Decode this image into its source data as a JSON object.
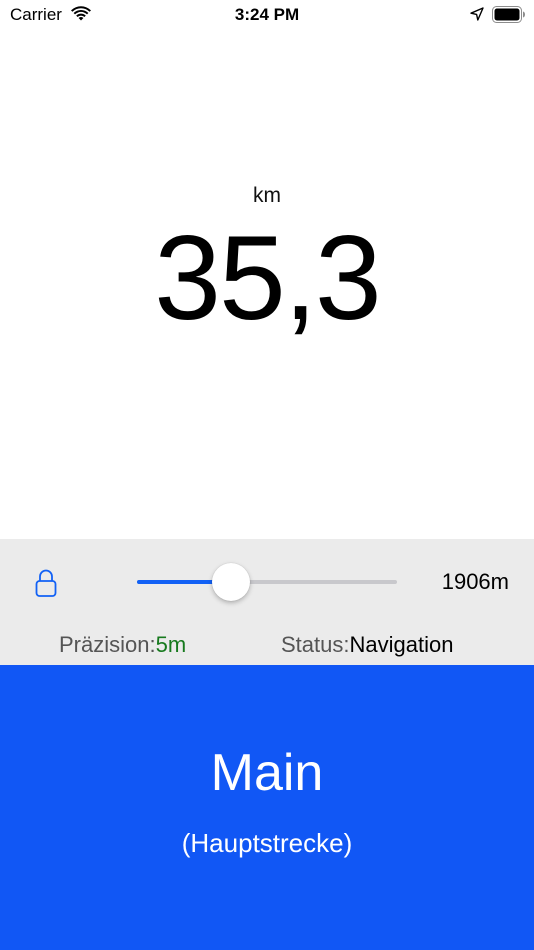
{
  "status_bar": {
    "carrier": "Carrier",
    "time": "3:24 PM",
    "icons": [
      "wifi-icon",
      "location-arrow-icon",
      "battery-icon"
    ]
  },
  "distance": {
    "unit": "km",
    "value": "35,3"
  },
  "controls": {
    "lock_icon": "lock-icon",
    "slider": {
      "level": 0.36,
      "accent_color": "#1261f5"
    },
    "slider_value": "1906m",
    "precision": {
      "label": "Präzision:",
      "value": "5m",
      "value_color": "#177a1e"
    },
    "status": {
      "label": "Status:",
      "value": "Navigation"
    }
  },
  "road": {
    "name": "Main",
    "subtitle": "(Hauptstrecke)",
    "background_color": "#1157f5"
  }
}
